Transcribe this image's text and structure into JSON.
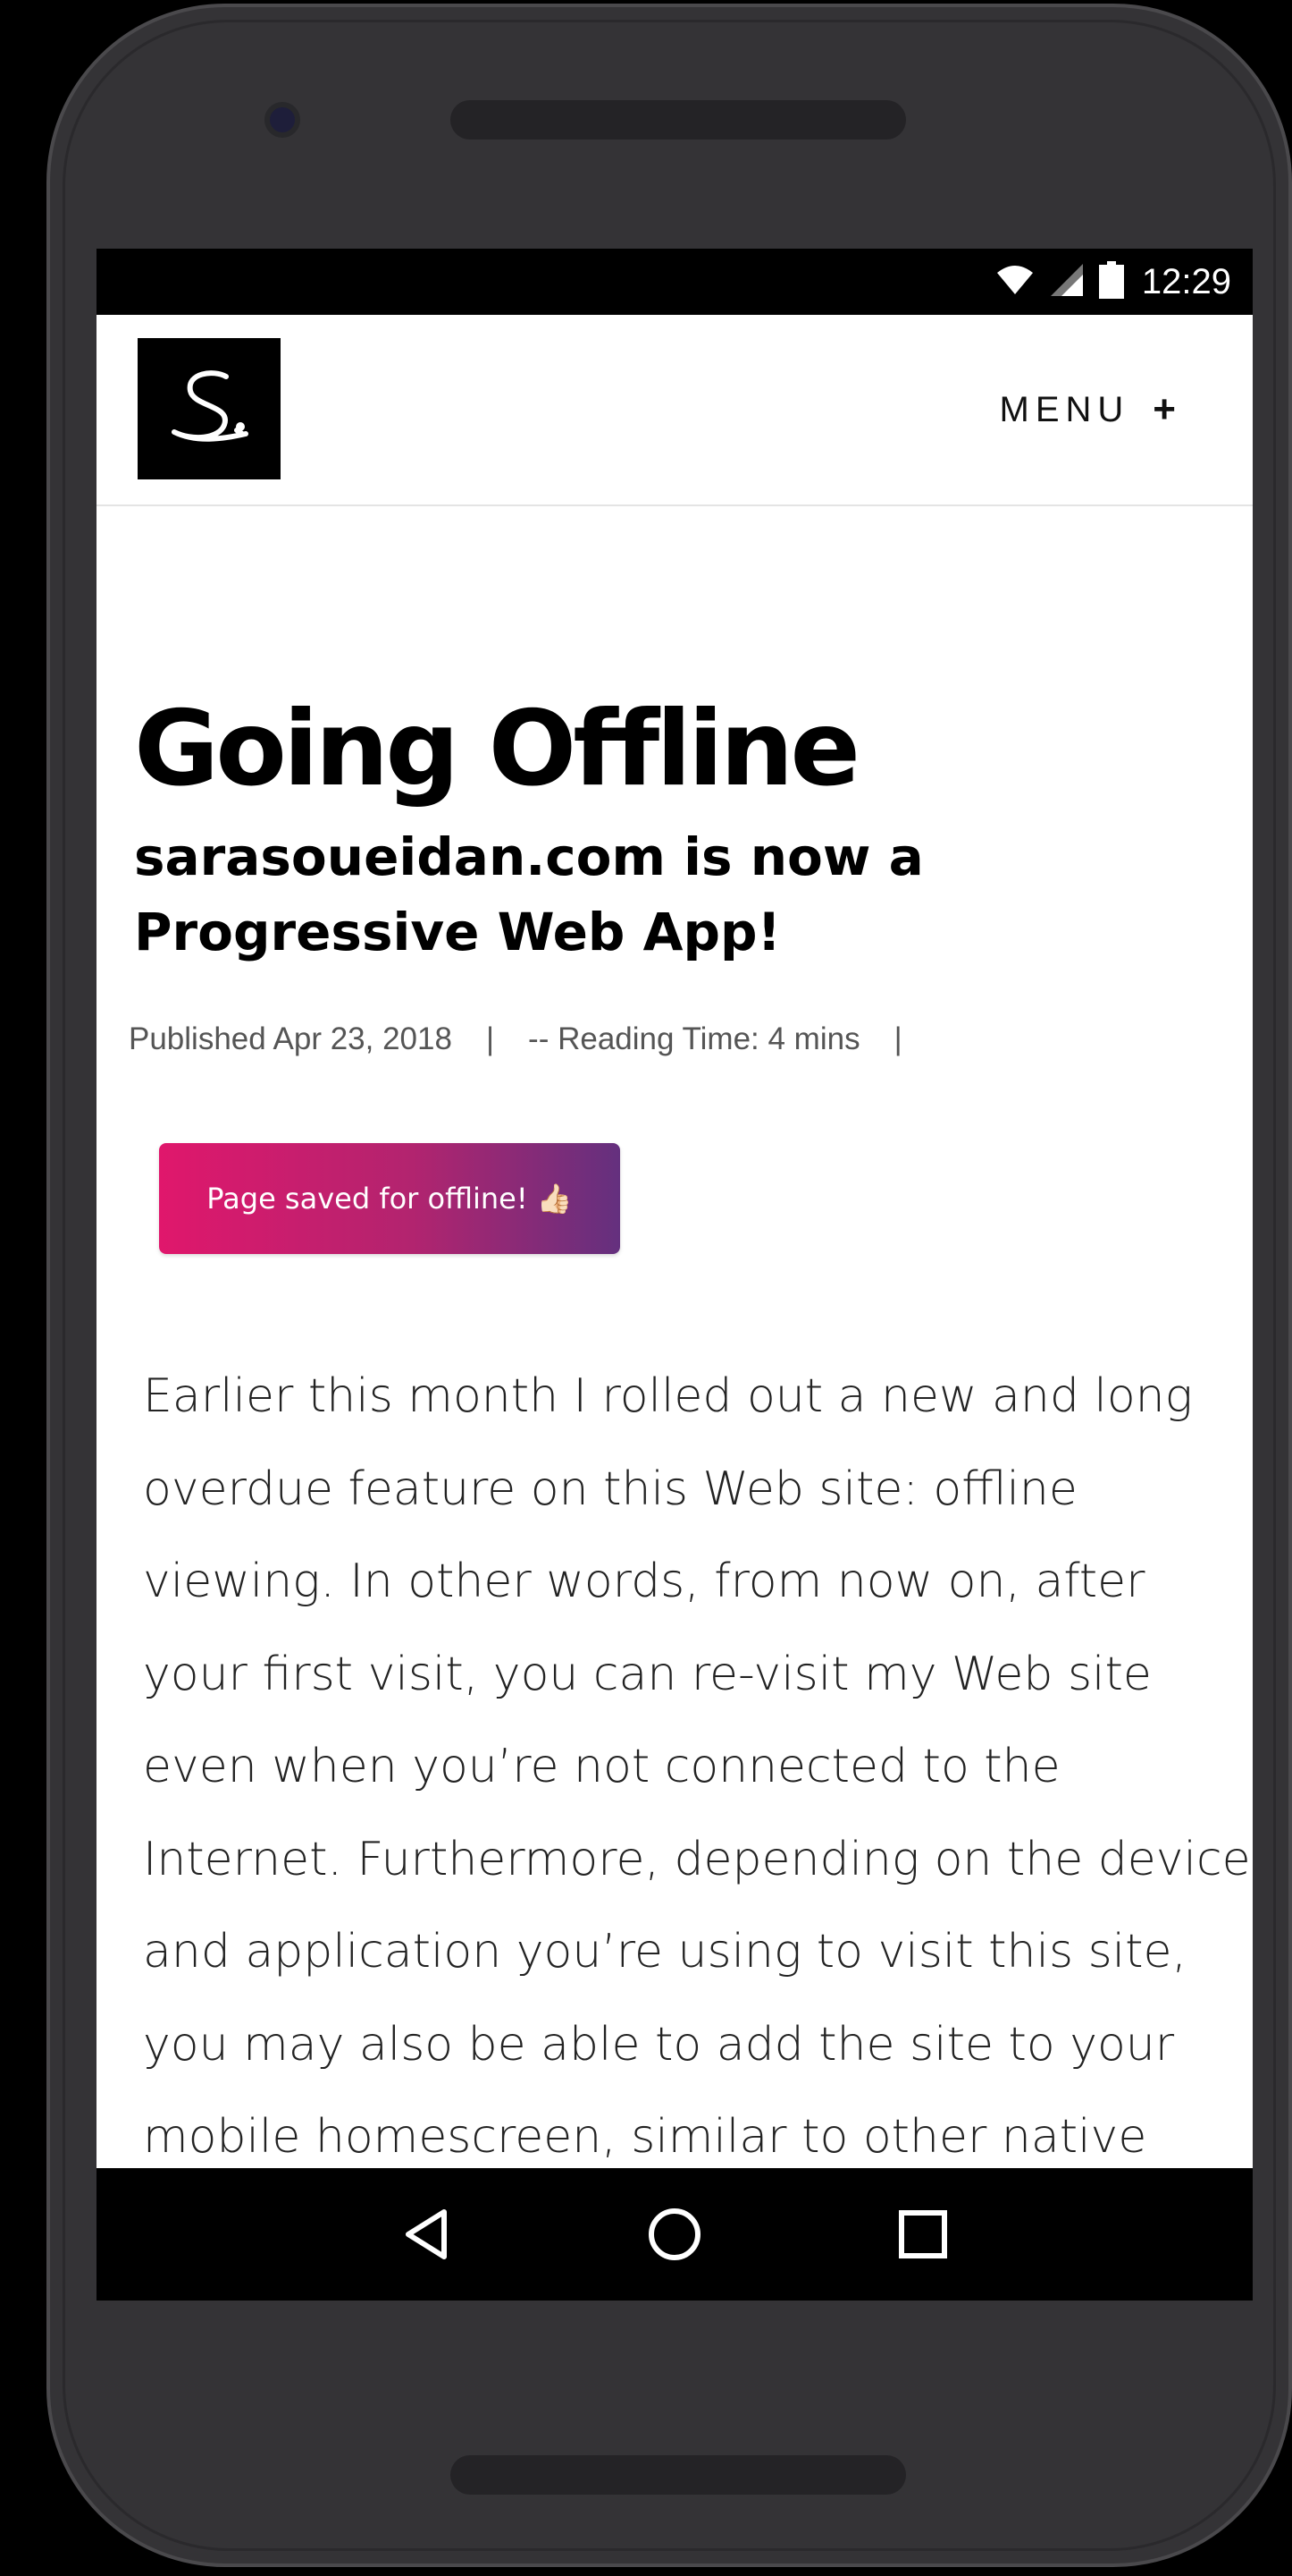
{
  "status_bar": {
    "time": "12:29",
    "icons": [
      "wifi-icon",
      "signal-icon",
      "battery-icon"
    ]
  },
  "header": {
    "logo_letter": "S.",
    "menu_label": "MENU",
    "menu_symbol": "+"
  },
  "post": {
    "title": "Going Offline",
    "subtitle": "sarasoueidan.com is now a Progressive Web App!",
    "published": "Published Apr 23, 2018",
    "separator": "|",
    "reading_time": "-- Reading Time: 4 mins",
    "offline_badge": "Page saved for offline! 👍🏻",
    "body": "Earlier this month I rolled out a new and long overdue feature on this Web site: offline viewing. In other words, from now on, after your first visit, you can re-visit my Web site even when you’re not connected to the Internet. Furthermore, depending on the device and application you’re using to visit this site, you may also be able to add the site to your mobile homescreen, similar to other native"
  },
  "navigation": {
    "buttons": [
      "back-icon",
      "home-icon",
      "recents-icon"
    ]
  },
  "colors": {
    "badge_gradient_start": "#e0176c",
    "badge_gradient_end": "#64307e",
    "phone_body": "#343336"
  }
}
